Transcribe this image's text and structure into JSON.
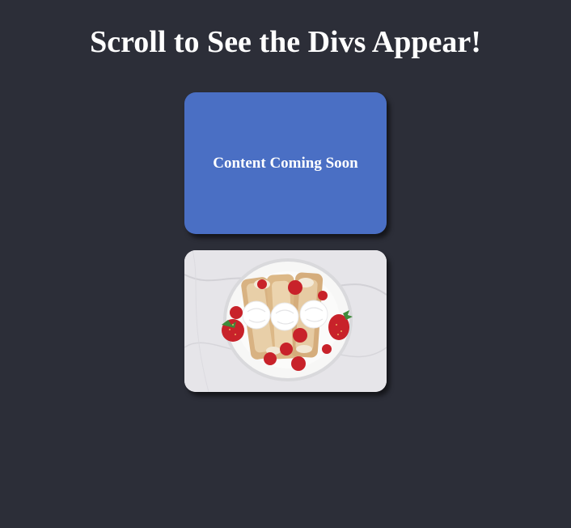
{
  "header": {
    "title": "Scroll to See the Divs Appear!"
  },
  "cards": [
    {
      "text": "Content Coming Soon",
      "color": "#4a6fc4"
    },
    {
      "image": "strawberry-crepes-photo"
    }
  ],
  "colors": {
    "background": "#2c2e38",
    "card_blue": "#4a6fc4",
    "text": "#ffffff"
  }
}
